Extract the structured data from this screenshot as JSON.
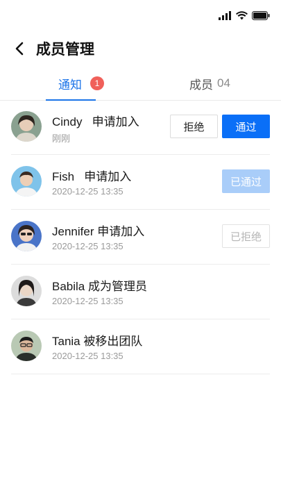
{
  "page": {
    "title": "成员管理"
  },
  "tabs": {
    "notice": {
      "label": "通知",
      "badge": "1"
    },
    "members": {
      "label": "成员",
      "count": "04"
    }
  },
  "notifications": [
    {
      "name": "Cindy",
      "action": "申请加入",
      "time": "刚刚",
      "reject_label": "拒绝",
      "approve_label": "通过"
    },
    {
      "name": "Fish",
      "action": "申请加入",
      "time": "2020-12-25   13:35",
      "status_label": "已通过"
    },
    {
      "name": "Jennifer",
      "action": "申请加入",
      "time": "2020-12-25   13:35",
      "status_label": "已拒绝"
    },
    {
      "name": "Babila",
      "action": "成为管理员",
      "time": "2020-12-25   13:35"
    },
    {
      "name": "Tania",
      "action": "被移出团队",
      "time": "2020-12-25   13:35"
    }
  ],
  "colors": {
    "accent": "#1a73e8",
    "primary_button": "#0a6ff7",
    "badge": "#f0605a"
  },
  "icons": [
    "signal-icon",
    "wifi-icon",
    "battery-icon",
    "back-arrow-icon"
  ]
}
